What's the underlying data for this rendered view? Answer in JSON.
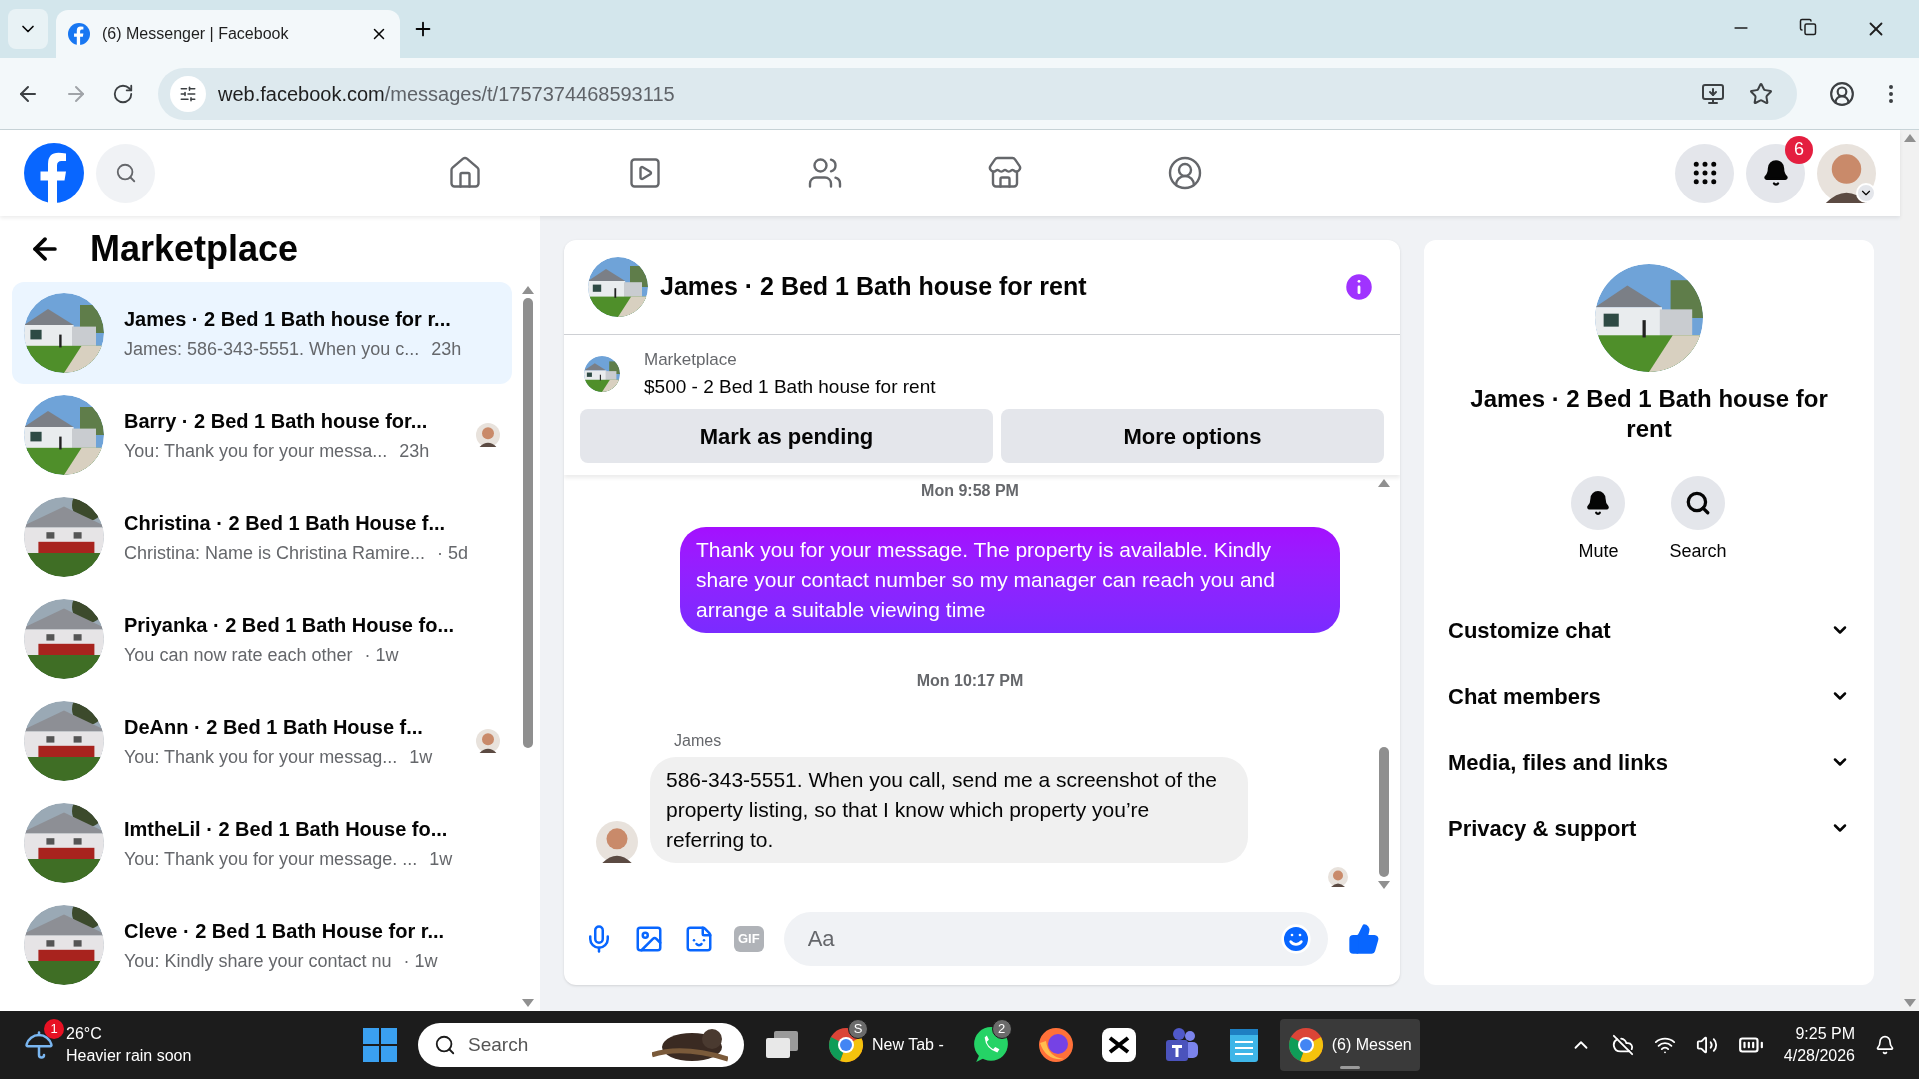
{
  "browser": {
    "tabs": [
      {
        "title": "(6) Messenger | Facebook",
        "selected": true
      }
    ],
    "url_host": "web.facebook.com",
    "url_path": "/messages/t/1757374468593115"
  },
  "top_nav": {
    "notification_count": "6"
  },
  "sidebar": {
    "title": "Marketplace",
    "conversations": [
      {
        "name": "James · 2 Bed 1 Bath house for r...",
        "preview": "James: 586-343-5551. When you c...",
        "time": "23h",
        "selected": true,
        "seen": false
      },
      {
        "name": "Barry · 2 Bed 1 Bath house for...",
        "preview": "You: Thank you for your messa...",
        "time": "23h",
        "selected": false,
        "seen": true
      },
      {
        "name": "Christina · 2 Bed 1 Bath House f...",
        "preview": "Christina: Name is Christina Ramire...",
        "time": "· 5d",
        "selected": false,
        "seen": false
      },
      {
        "name": "Priyanka · 2 Bed 1 Bath House fo...",
        "preview": "You can now rate each other",
        "time": "· 1w",
        "selected": false,
        "seen": false
      },
      {
        "name": "DeAnn · 2 Bed 1 Bath House f...",
        "preview": "You: Thank you for your messag...",
        "time": "1w",
        "selected": false,
        "seen": true
      },
      {
        "name": "ImtheLil · 2 Bed 1 Bath House fo...",
        "preview": "You: Thank you for your message. ...",
        "time": "1w",
        "selected": false,
        "seen": false
      },
      {
        "name": "Cleve · 2 Bed 1 Bath House for r...",
        "preview": "You: Kindly share your contact nu",
        "time": "· 1w",
        "selected": false,
        "seen": false
      }
    ]
  },
  "chat": {
    "title": "James · 2 Bed 1 Bath house for rent",
    "listing_label": "Marketplace",
    "listing_title": "$500 - 2 Bed 1 Bath house for rent",
    "buttons": [
      "Mark as pending",
      "More options"
    ],
    "messages": [
      {
        "kind": "timestamp",
        "text": "Mon 9:58 PM"
      },
      {
        "kind": "outgoing",
        "text": "Thank you for your message. The property is available. Kindly share your contact number so my manager can reach you and arrange a suitable viewing time"
      },
      {
        "kind": "timestamp",
        "text": "Mon 10:17 PM"
      },
      {
        "kind": "incoming",
        "sender": "James",
        "text": "586-343-5551. When you call, send me a screenshot of the property listing, so that I know which property you’re referring to."
      }
    ],
    "gif_label": "GIF",
    "composer_placeholder": "Aa"
  },
  "details": {
    "title": "James · 2 Bed 1 Bath house for rent",
    "actions": [
      "Mute",
      "Search"
    ],
    "sections": [
      {
        "label": "Customize chat",
        "expanded": false
      },
      {
        "label": "Chat members",
        "expanded": false
      },
      {
        "label": "Media, files and links",
        "expanded": false
      },
      {
        "label": "Privacy & support",
        "expanded": false
      }
    ]
  },
  "taskbar": {
    "weather_badge": "1",
    "temperature": "26°C",
    "forecast": "Heavier rain soon",
    "search_placeholder": "Search",
    "apps": [
      {
        "kind": "windows"
      },
      {
        "kind": "taskview"
      },
      {
        "kind": "browser",
        "label": "New Tab -",
        "badge": "S",
        "selected": false
      },
      {
        "kind": "chat",
        "badge": "2",
        "selected": false
      },
      {
        "kind": "fox",
        "selected": false
      },
      {
        "kind": "editor",
        "selected": false
      },
      {
        "kind": "teams",
        "selected": false
      },
      {
        "kind": "notepad",
        "selected": false
      },
      {
        "kind": "browser",
        "label": "(6) Messen",
        "selected": true
      }
    ],
    "time": "9:25 PM",
    "date": "4/28/2026"
  }
}
